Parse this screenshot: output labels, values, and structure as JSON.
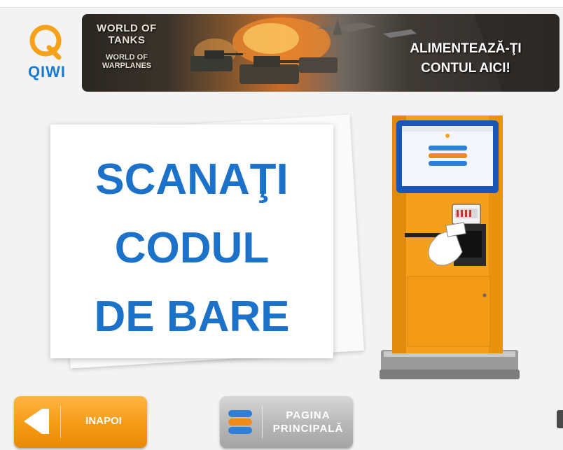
{
  "brand": {
    "logo_text": "QIWI"
  },
  "banner": {
    "game_logo_line1": "WORLD OF TANKS",
    "game_logo_line2": "WORLD OF WARPLANES",
    "cta_line1": "ALIMENTEAZĂ-ŢI",
    "cta_line2": "CONTUL AICI!"
  },
  "instruction": {
    "line1": "SCANAŢI",
    "line2": "CODUL",
    "line3": "DE BARE"
  },
  "buttons": {
    "back_label": "INAPOI",
    "home_line1": "PAGINA",
    "home_line2": "PRINCIPALĂ"
  },
  "colors": {
    "accent_blue": "#1b72c8",
    "kiosk_orange": "#f7a21b",
    "back_button": "#f59a14",
    "home_button": "#b7b7b7"
  },
  "icons": {
    "logo": "qiwi-logo-icon",
    "back": "arrow-left-icon",
    "home": "home-stack-icon"
  }
}
